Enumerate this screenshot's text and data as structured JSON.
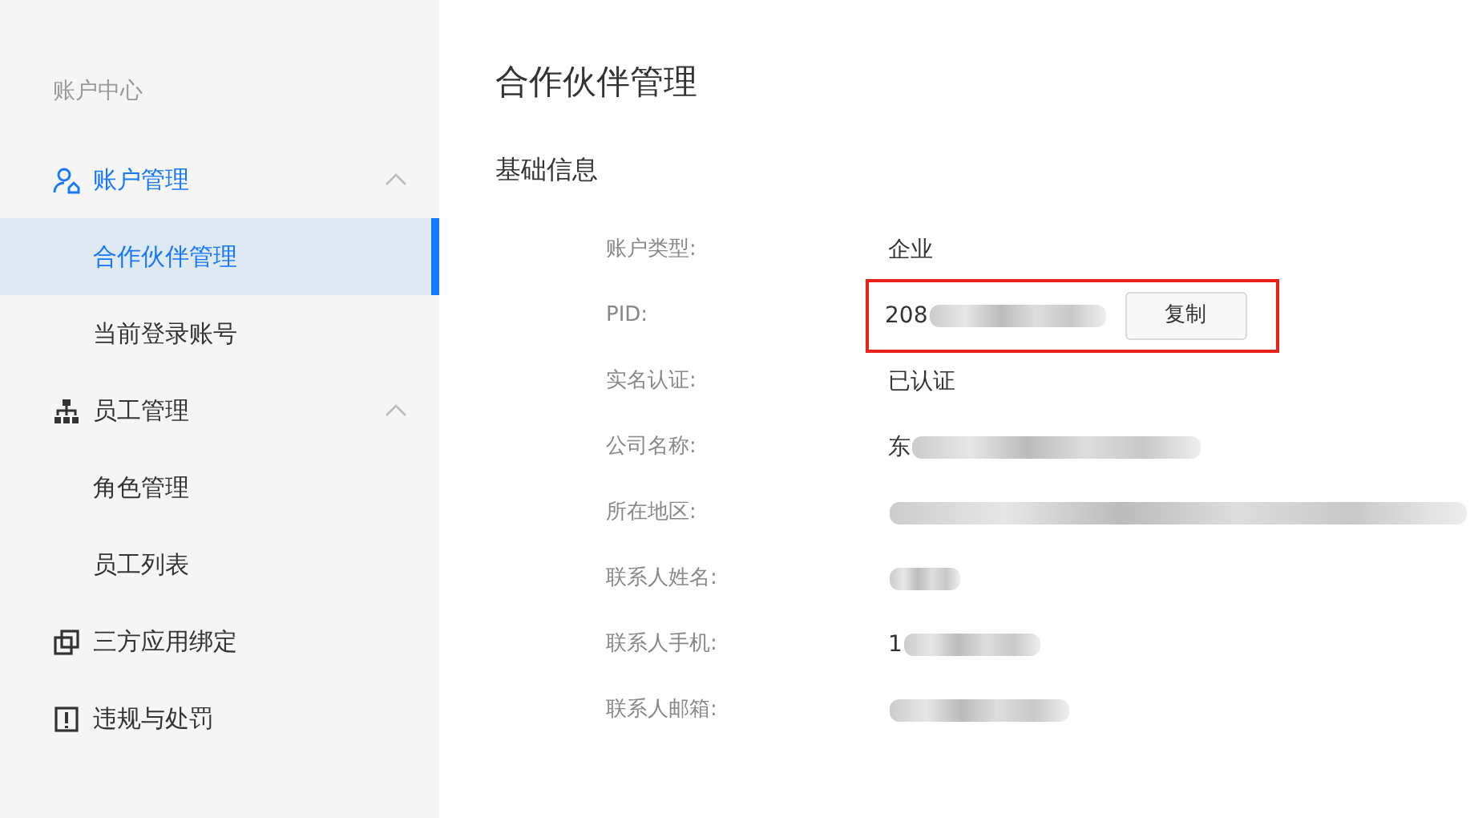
{
  "sidebar": {
    "heading": "账户中心",
    "items": [
      {
        "label": "账户管理",
        "kind": "user",
        "expanded": true,
        "active": true,
        "children": [
          {
            "label": "合作伙伴管理",
            "selected": true
          },
          {
            "label": "当前登录账号",
            "selected": false
          }
        ]
      },
      {
        "label": "员工管理",
        "kind": "org",
        "expanded": true,
        "active": false,
        "children": [
          {
            "label": "角色管理",
            "selected": false
          },
          {
            "label": "员工列表",
            "selected": false
          }
        ]
      },
      {
        "label": "三方应用绑定",
        "kind": "link",
        "active": false
      },
      {
        "label": "违规与处罚",
        "kind": "alert",
        "active": false
      }
    ]
  },
  "page_title": "合作伙伴管理",
  "section_title": "基础信息",
  "fields": [
    {
      "label": "账户类型:",
      "value": "企业",
      "redacted": false
    },
    {
      "label": "PID:",
      "value": "208",
      "redacted": true,
      "highlighted": true,
      "button": "复制"
    },
    {
      "label": "实名认证:",
      "value": "已认证",
      "redacted": false
    },
    {
      "label": "公司名称:",
      "value": "东",
      "redacted": true
    },
    {
      "label": "所在地区:",
      "redacted": true
    },
    {
      "label": "联系人姓名:",
      "redacted": true
    },
    {
      "label": "联系人手机:",
      "value": "1",
      "redacted": true
    },
    {
      "label": "联系人邮箱:",
      "redacted": true
    }
  ]
}
